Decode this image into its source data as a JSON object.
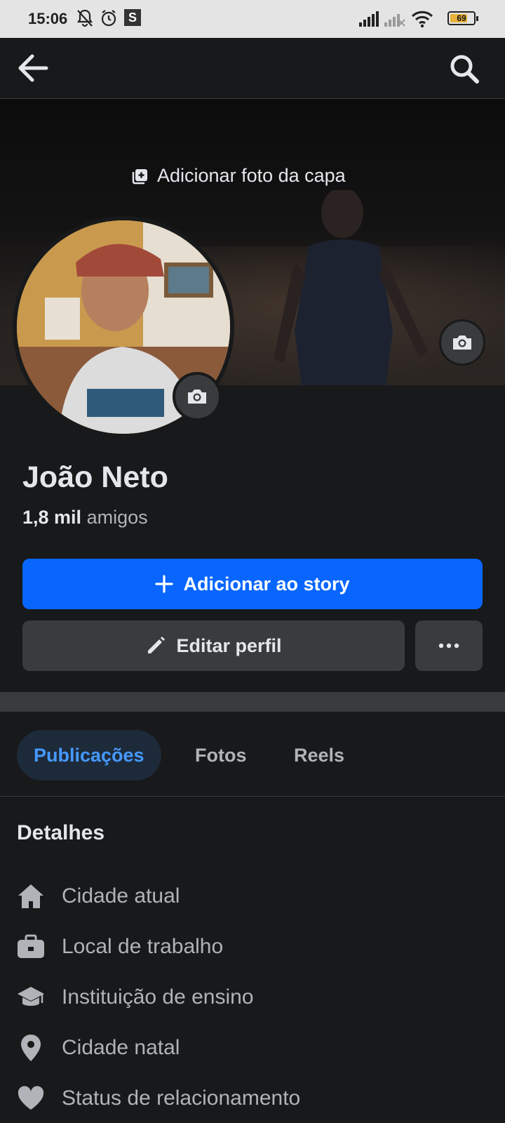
{
  "status_bar": {
    "time": "15:06",
    "app_badge": "S",
    "battery_level": "69"
  },
  "header": {
    "back_icon": "arrow-left-icon",
    "search_icon": "search-icon"
  },
  "cover": {
    "add_cover_label": "Adicionar foto da capa"
  },
  "profile": {
    "name": "João Neto",
    "friends_count": "1,8 mil",
    "friends_label": "amigos"
  },
  "actions": {
    "add_story_label": "Adicionar ao story",
    "edit_profile_label": "Editar perfil"
  },
  "tabs": [
    {
      "label": "Publicações",
      "active": true
    },
    {
      "label": "Fotos",
      "active": false
    },
    {
      "label": "Reels",
      "active": false
    }
  ],
  "details": {
    "title": "Detalhes",
    "items": [
      {
        "label": "Cidade atual",
        "icon": "home-icon"
      },
      {
        "label": "Local de trabalho",
        "icon": "briefcase-icon"
      },
      {
        "label": "Instituição de ensino",
        "icon": "graduation-cap-icon"
      },
      {
        "label": "Cidade natal",
        "icon": "location-pin-icon"
      },
      {
        "label": "Status de relacionamento",
        "icon": "heart-icon"
      }
    ]
  },
  "colors": {
    "accent": "#0866ff",
    "background": "#18191a",
    "surface": "#3a3b3c",
    "active_tab_text": "#4599ff"
  }
}
